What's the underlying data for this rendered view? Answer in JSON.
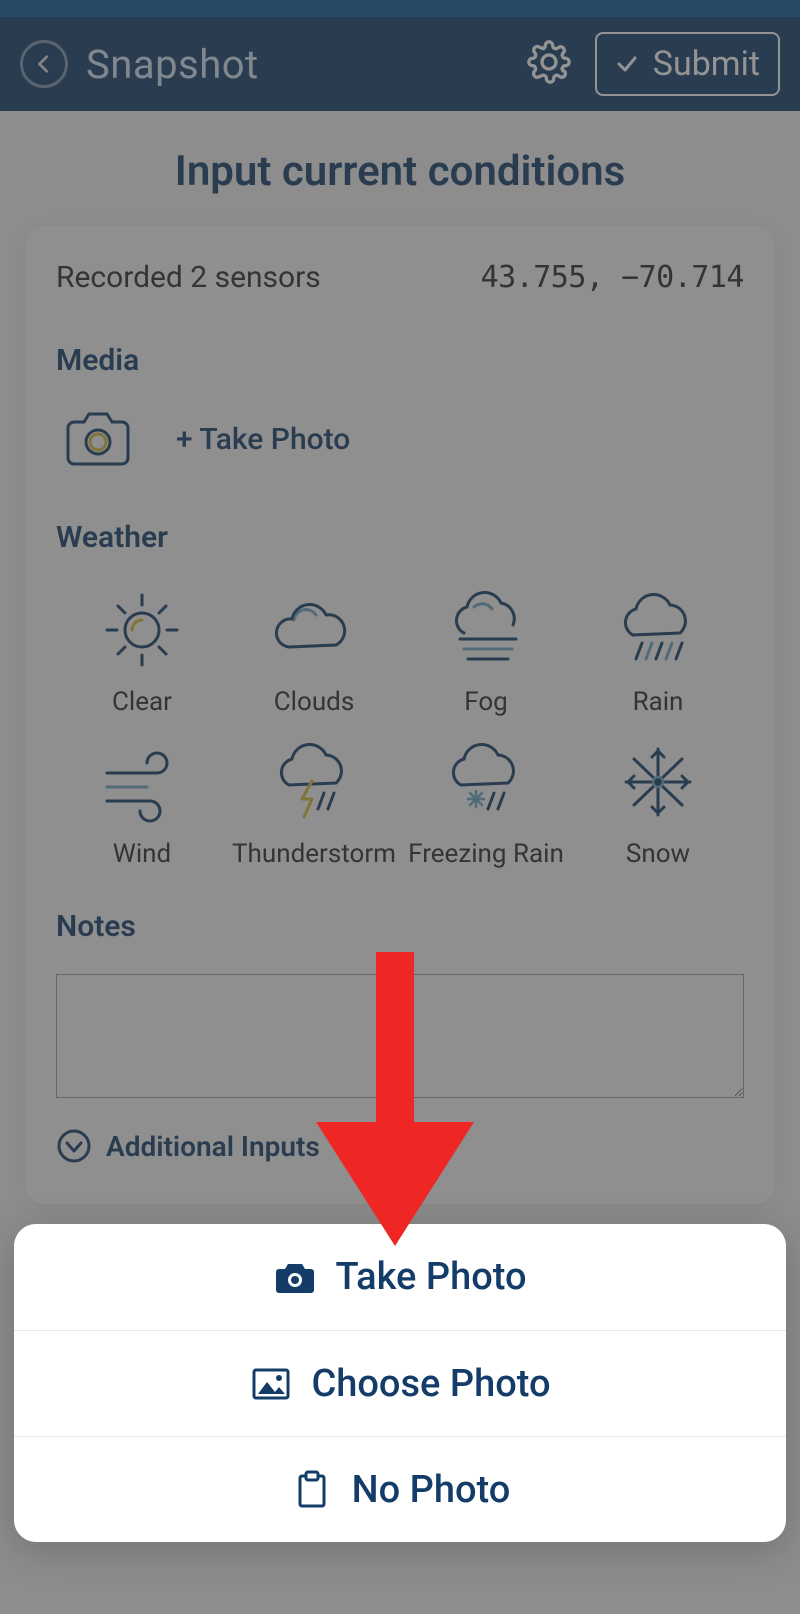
{
  "header": {
    "title": "Snapshot",
    "submit_label": "Submit"
  },
  "page": {
    "title": "Input current conditions",
    "recorded_text": "Recorded 2 sensors",
    "coords": "43.755, −70.714"
  },
  "sections": {
    "media_label": "Media",
    "weather_label": "Weather",
    "notes_label": "Notes",
    "additional_label": "Additional Inputs"
  },
  "media": {
    "take_photo_label": "+ Take Photo"
  },
  "weather": {
    "items": [
      {
        "label": "Clear"
      },
      {
        "label": "Clouds"
      },
      {
        "label": "Fog"
      },
      {
        "label": "Rain"
      },
      {
        "label": "Wind"
      },
      {
        "label": "Thunderstorm"
      },
      {
        "label": "Freezing Rain"
      },
      {
        "label": "Snow"
      }
    ]
  },
  "notes": {
    "value": ""
  },
  "sheet": {
    "take_photo": "Take Photo",
    "choose_photo": "Choose Photo",
    "no_photo": "No Photo"
  }
}
